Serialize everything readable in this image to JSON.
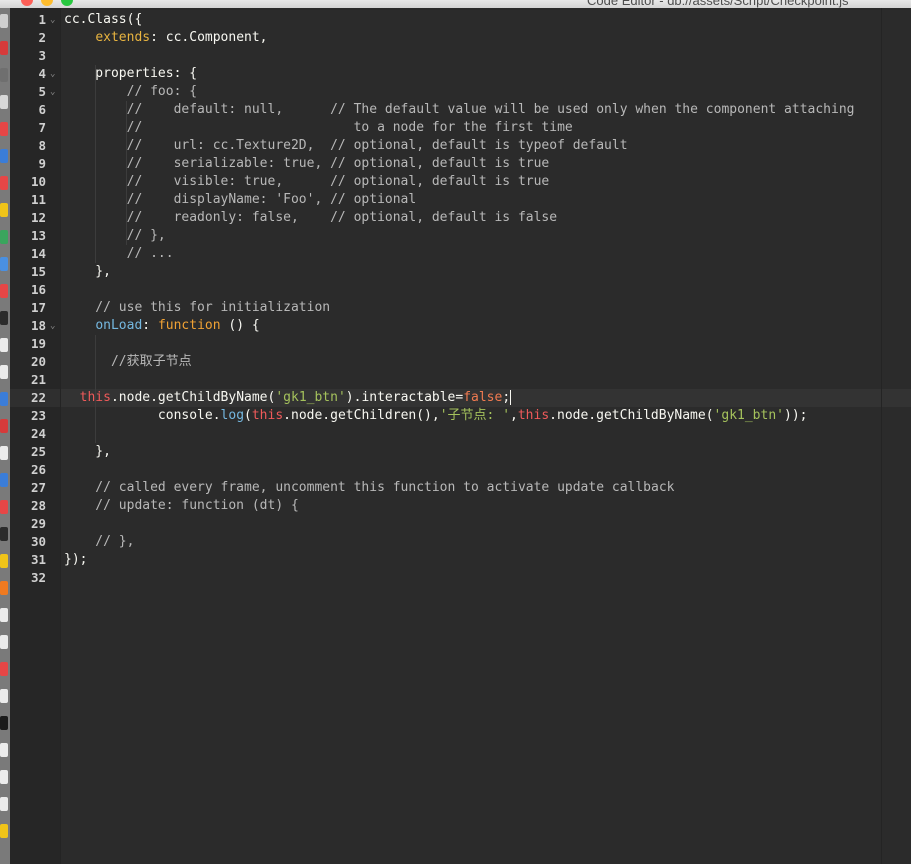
{
  "window": {
    "title": "Code Editor - db://assets/Script/Checkpoint.js"
  },
  "editor": {
    "line_numbers": [
      "1",
      "2",
      "3",
      "4",
      "5",
      "6",
      "7",
      "8",
      "9",
      "10",
      "11",
      "12",
      "13",
      "14",
      "15",
      "16",
      "17",
      "18",
      "19",
      "20",
      "21",
      "22",
      "23",
      "24",
      "25",
      "26",
      "27",
      "28",
      "29",
      "30",
      "31",
      "32"
    ],
    "fold_markers": {
      "1": "⌄",
      "4": "⌄",
      "5": "⌄",
      "18": "⌄"
    },
    "current_line": 22,
    "lines": [
      [
        [
          "cc.Class({",
          "def"
        ]
      ],
      [
        [
          "    ",
          "def"
        ],
        [
          "extends",
          "key"
        ],
        [
          ": cc.Component,",
          "def"
        ]
      ],
      [],
      [
        [
          "    properties: {",
          "def"
        ]
      ],
      [
        [
          "        // foo: {",
          "com"
        ]
      ],
      [
        [
          "        //    default: null,      // The default value will be used only when the component attaching",
          "com"
        ]
      ],
      [
        [
          "        //                           to a node for the first time",
          "com"
        ]
      ],
      [
        [
          "        //    url: cc.Texture2D,  // optional, default is typeof default",
          "com"
        ]
      ],
      [
        [
          "        //    serializable: true, // optional, default is true",
          "com"
        ]
      ],
      [
        [
          "        //    visible: true,      // optional, default is true",
          "com"
        ]
      ],
      [
        [
          "        //    displayName: 'Foo', // optional",
          "com"
        ]
      ],
      [
        [
          "        //    readonly: false,    // optional, default is false",
          "com"
        ]
      ],
      [
        [
          "        // },",
          "com"
        ]
      ],
      [
        [
          "        // ...",
          "com"
        ]
      ],
      [
        [
          "    },",
          "def"
        ]
      ],
      [],
      [
        [
          "    // use this for initialization",
          "com"
        ]
      ],
      [
        [
          "    ",
          "def"
        ],
        [
          "onLoad",
          "fn"
        ],
        [
          ": ",
          "def"
        ],
        [
          "function",
          "kw"
        ],
        [
          " () {",
          "def"
        ]
      ],
      [],
      [
        [
          "      //获取子节点",
          "com"
        ]
      ],
      [],
      [
        [
          "  ",
          "def"
        ],
        [
          "this",
          "this"
        ],
        [
          ".node.getChildByName(",
          "def"
        ],
        [
          "'gk1_btn'",
          "str"
        ],
        [
          ").interactable=",
          "def"
        ],
        [
          "false",
          "bool"
        ],
        [
          ";",
          "def"
        ]
      ],
      [
        [
          "            console.",
          "def"
        ],
        [
          "log",
          "fn"
        ],
        [
          "(",
          "def"
        ],
        [
          "this",
          "this"
        ],
        [
          ".node.getChildren(),",
          "def"
        ],
        [
          "'子节点: '",
          "str"
        ],
        [
          ",",
          "def"
        ],
        [
          "this",
          "this"
        ],
        [
          ".node.getChildByName(",
          "def"
        ],
        [
          "'gk1_btn'",
          "str"
        ],
        [
          "));",
          "def"
        ]
      ],
      [],
      [
        [
          "    },",
          "def"
        ]
      ],
      [],
      [
        [
          "    // called every frame, uncomment this function to activate update callback",
          "com"
        ]
      ],
      [
        [
          "    // update: function (dt) {",
          "com"
        ]
      ],
      [],
      [
        [
          "    // },",
          "com"
        ]
      ],
      [
        [
          "});",
          "def"
        ]
      ],
      []
    ]
  },
  "dock_icon_colors": [
    "#cfcfcf",
    "#d63b3b",
    "#6f6f6f",
    "#d8d8d8",
    "#e64646",
    "#3b7dd8",
    "#e64646",
    "#f0c419",
    "#3aa55d",
    "#4a90e2",
    "#e64646",
    "#2b2b2b",
    "#ececec",
    "#ececec",
    "#3b7dd8",
    "#d63b3b",
    "#ececec",
    "#3b7dd8",
    "#e64646",
    "#2b2b2b",
    "#f0c419",
    "#f07a20",
    "#ececec",
    "#ececec",
    "#e64646",
    "#ececec",
    "#1b1b1b",
    "#ececec",
    "#ececec",
    "#ececec",
    "#f0c419"
  ]
}
